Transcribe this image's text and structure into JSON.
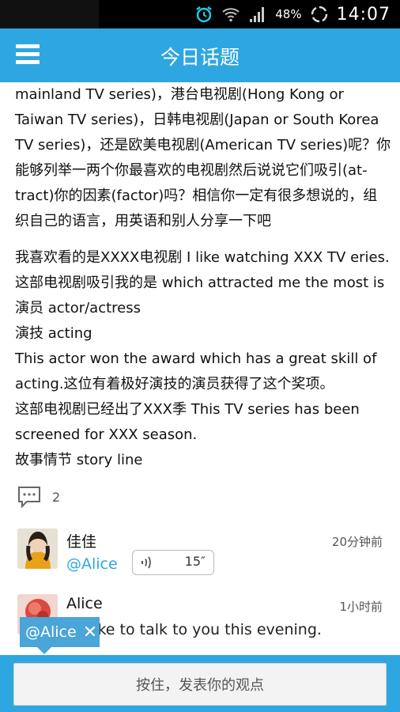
{
  "status_bar": {
    "battery_percent": "48%",
    "time": "14:07"
  },
  "header": {
    "title": "今日话题"
  },
  "content": {
    "paragraph1": [
      "mainland TV series)，港台电视剧(Hong Kong or",
      "Taiwan TV series)，日韩电视剧(Japan or South Korea",
      "TV series)，还是欧美电视剧(American TV series)呢？你",
      "能够列举一两个你最喜欢的电视剧然后说说它们吸引(at-",
      "tract)你的因素(factor)吗？相信你一定有很多想说的，组",
      "织自己的语言，用英语和别人分享一下吧"
    ],
    "paragraph2": [
      "我喜欢看的是XXXX电视剧 I like watching XXX TV eries.",
      "这部电视剧吸引我的是 which attracted me the most is",
      "演员 actor/actress",
      "演技 acting",
      "This actor won the award which has a great skill of",
      "acting.这位有着极好演技的演员获得了这个奖项。",
      "这部电视剧已经出了XXX季 This TV series has been",
      "screened for XXX season.",
      "故事情节 story line"
    ]
  },
  "comments": {
    "count": "2"
  },
  "items": [
    {
      "name": "佳佳",
      "time": "20分钟前",
      "mention": "@Alice",
      "voice_duration": "15″"
    },
    {
      "name": "Alice",
      "time": "1小时前",
      "message": "I'd like to talk to you this evening."
    }
  ],
  "mention_chip": {
    "label": "@Alice",
    "close": "✕"
  },
  "bottom": {
    "press_label": "按住，发表你的观点"
  },
  "colors": {
    "accent": "#2ea6e1",
    "chip": "#4aa5d8"
  }
}
